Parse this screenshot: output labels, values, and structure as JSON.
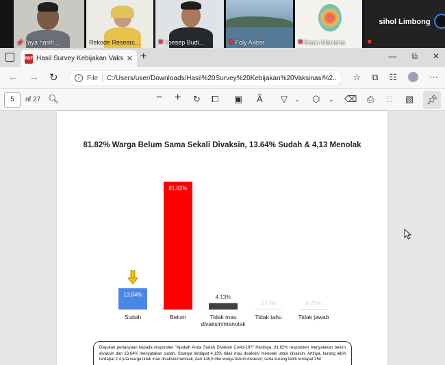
{
  "meeting": {
    "participants": [
      {
        "name": "Jaya hasih...",
        "mic_muted": false
      },
      {
        "name": "Rekode Researc...",
        "mic_muted": false
      },
      {
        "name": "Yoesep Budi...",
        "mic_muted": true
      },
      {
        "name": "Foly Akbar",
        "mic_muted": true
      },
      {
        "name": "Ihsan Maulana",
        "mic_muted": true
      },
      {
        "name": "sihol Limbong",
        "mic_muted": true
      }
    ]
  },
  "browser": {
    "tab_title": "Hasil Survey Kebijakan Vaksinasi",
    "file_label": "File",
    "url": "C:/Users/user/Downloads/Hasil%20Survey%20Kebijakan%20Vaksinasi%2...",
    "page_number": "5",
    "page_count": "of 27"
  },
  "chart_data": {
    "type": "bar",
    "title": "81.82% Warga Belum Sama Sekali Divaksin, 13.64% Sudah & 4,13 Menolak",
    "categories": [
      "Sudah",
      "Belum",
      "Tidak mau divaksin/menolak",
      "Tidak tahu",
      "Tidak jawab"
    ],
    "category_lines": [
      [
        "Sudah"
      ],
      [
        "Belum"
      ],
      [
        "Tidak mau",
        "divaksin/menolak"
      ],
      [
        "Tidak tahu"
      ],
      [
        "Tidak jawab"
      ]
    ],
    "values": [
      13.64,
      81.82,
      4.13,
      0.17,
      0.25
    ],
    "labels": [
      "13.64%",
      "81.82%",
      "4.13%",
      "0.17%",
      "0.25%"
    ],
    "colors": [
      "#4a86e8",
      "#ff0000",
      "#404040",
      "#bfbfbf",
      "#bfbfbf"
    ],
    "highlight_arrow_on": "Sudah",
    "ylim": [
      0,
      100
    ],
    "grid": false
  },
  "caption": "Diajukan pertanyaan kepada responden \"Apakah Anda Sudah Divaksin Covid-19?\" Hasilnya, 81,82% responden menyatakan belum divaksin dan 13.64% menyatakan sudah. Sisanya terdapat 4.13% tidak mau divaksin/ menolak untuk divaksin. Artinya, kurang lebih terdapat 2,4 juta warga tidak mau divaksin/menolak; dan 148,5 ribu warga belum divaksin; serta kurang lebih terdapat 25ri"
}
